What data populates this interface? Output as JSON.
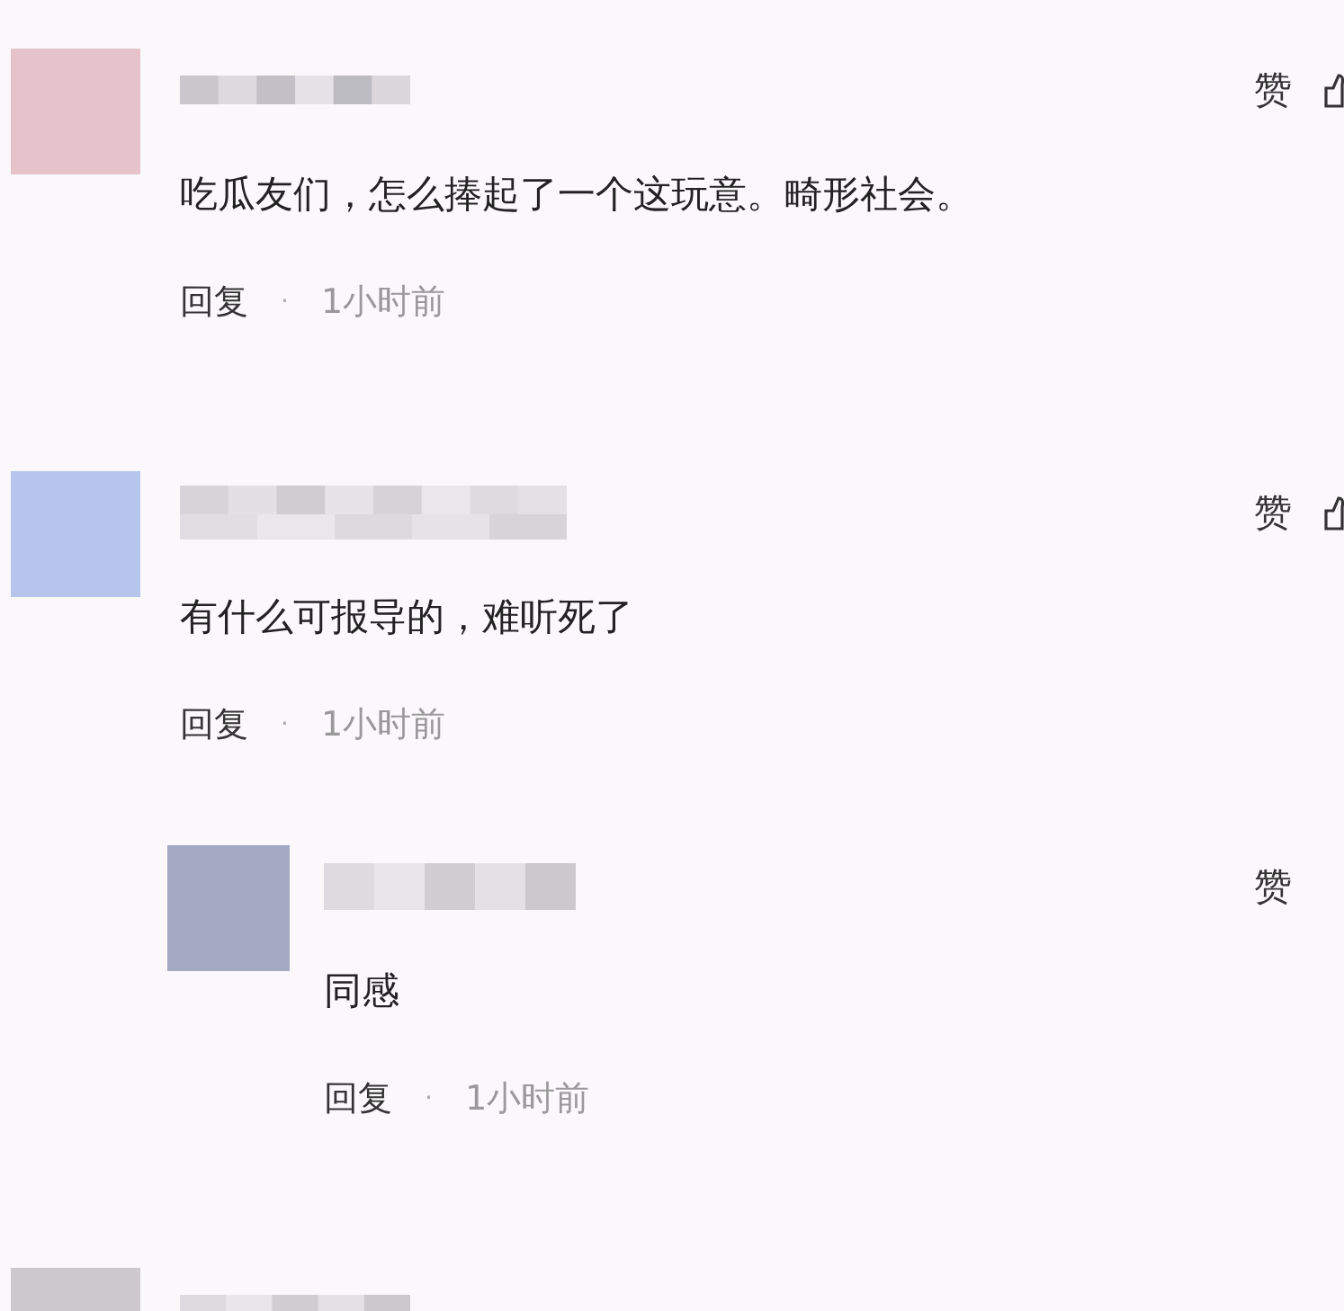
{
  "comments": [
    {
      "color": "#e6c3cb",
      "like_label": "赞",
      "text": "吃瓜友们，怎么捧起了一个这玩意。畸形社会。",
      "reply_label": "回复",
      "separator": "·",
      "time": "1小时前"
    },
    {
      "color": "#b7c4ec",
      "like_label": "赞",
      "text": "有什么可报导的，难听死了",
      "reply_label": "回复",
      "separator": "·",
      "time": "1小时前",
      "children": [
        {
          "color": "#a3a9c0",
          "like_label": "赞",
          "text": "同感",
          "reply_label": "回复",
          "separator": "·",
          "time": "1小时前"
        }
      ]
    },
    {
      "color": "#cdc8cc"
    }
  ]
}
